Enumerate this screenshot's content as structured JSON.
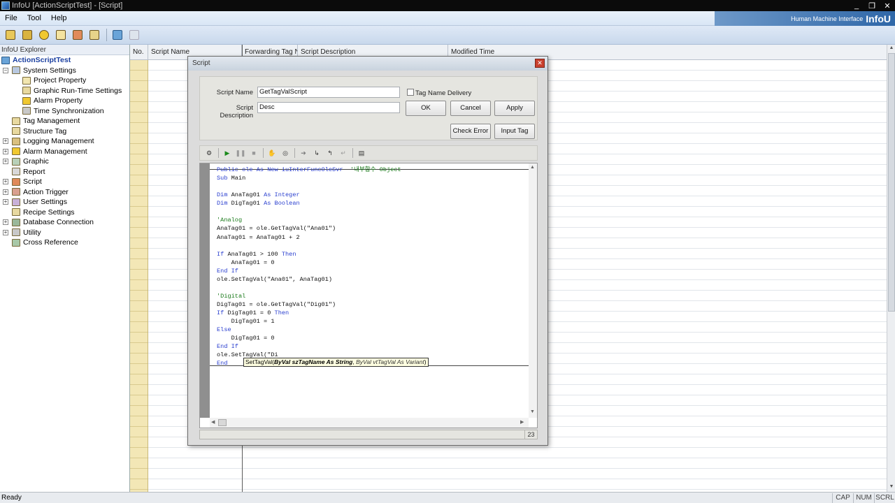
{
  "window": {
    "title": "InfoU [ActionScriptTest] - [Script]",
    "minimize": "_",
    "restore": "❐",
    "close": "✕"
  },
  "menu": [
    "File",
    "Tool",
    "Help"
  ],
  "brand": {
    "subtitle": "Human Machine Interface",
    "name": "InfoU"
  },
  "explorer": {
    "title": "InfoU Explorer",
    "root": "ActionScriptTest",
    "items": [
      {
        "label": "System Settings",
        "level": 1,
        "expanded": true
      },
      {
        "label": "Project Property",
        "level": 2
      },
      {
        "label": "Graphic Run-Time Settings",
        "level": 2
      },
      {
        "label": "Alarm Property",
        "level": 2
      },
      {
        "label": "Time Synchronization",
        "level": 2
      },
      {
        "label": "Tag Management",
        "level": 1
      },
      {
        "label": "Structure Tag",
        "level": 1
      },
      {
        "label": "Logging Management",
        "level": 1,
        "expanded": false
      },
      {
        "label": "Alarm Management",
        "level": 1,
        "expanded": false
      },
      {
        "label": "Graphic",
        "level": 1,
        "expanded": false
      },
      {
        "label": "Report",
        "level": 1
      },
      {
        "label": "Script",
        "level": 1,
        "expanded": false
      },
      {
        "label": "Action Trigger",
        "level": 1,
        "expanded": false
      },
      {
        "label": "User Settings",
        "level": 1,
        "expanded": false
      },
      {
        "label": "Recipe Settings",
        "level": 1
      },
      {
        "label": "Database Connection",
        "level": 1,
        "expanded": false
      },
      {
        "label": "Utility",
        "level": 1,
        "expanded": false
      },
      {
        "label": "Cross Reference",
        "level": 1
      }
    ]
  },
  "grid": {
    "columns": [
      "No.",
      "Script Name",
      "Forwarding Tag N...",
      "Script Description",
      "Modified Time"
    ]
  },
  "status": {
    "text": "Ready",
    "caps": "CAP",
    "num": "NUM",
    "scrl": "SCRL"
  },
  "dialog": {
    "title": "Script",
    "script_name_label": "Script Name",
    "script_name_value": "GetTagValScript",
    "tag_delivery_label": "Tag Name Delivery",
    "tag_delivery_checked": false,
    "script_desc_label": "Script Description",
    "script_desc_value": "Desc",
    "ok": "OK",
    "cancel": "Cancel",
    "apply": "Apply",
    "check_error": "Check Error",
    "input_tag": "Input Tag",
    "line_number": "23",
    "code_lines": [
      [
        [
          "kw",
          "Public ole As New iuInterFuncOleSvr"
        ],
        [
          "cm",
          "  '내부함수 Object"
        ]
      ],
      [
        [
          "kw",
          "Sub "
        ],
        [
          "pl",
          "Main"
        ]
      ],
      [],
      [
        [
          "kw",
          "Dim "
        ],
        [
          "pl",
          "AnaTag01 "
        ],
        [
          "kw",
          "As Integer"
        ]
      ],
      [
        [
          "kw",
          "Dim "
        ],
        [
          "pl",
          "DigTag01 "
        ],
        [
          "kw",
          "As Boolean"
        ]
      ],
      [],
      [
        [
          "cm",
          "'Analog"
        ]
      ],
      [
        [
          "pl",
          "AnaTag01 = ole.GetTagVal(\"Ana01\")"
        ]
      ],
      [
        [
          "pl",
          "AnaTag01 = AnaTag01 + 2"
        ]
      ],
      [],
      [
        [
          "kw",
          "If "
        ],
        [
          "pl",
          "AnaTag01 > 100 "
        ],
        [
          "kw",
          "Then"
        ]
      ],
      [
        [
          "pl",
          "    AnaTag01 = 0"
        ]
      ],
      [
        [
          "kw",
          "End If"
        ]
      ],
      [
        [
          "pl",
          "ole.SetTagVal(\"Ana01\", AnaTag01)"
        ]
      ],
      [],
      [
        [
          "cm",
          "'Digital"
        ]
      ],
      [
        [
          "pl",
          "DigTag01 = ole.GetTagVal(\"Dig01\")"
        ]
      ],
      [
        [
          "kw",
          "If "
        ],
        [
          "pl",
          "DigTag01 = 0 "
        ],
        [
          "kw",
          "Then"
        ]
      ],
      [
        [
          "pl",
          "    DigTag01 = 1"
        ]
      ],
      [
        [
          "kw",
          "Else"
        ]
      ],
      [
        [
          "pl",
          "    DigTag01 = 0"
        ]
      ],
      [
        [
          "kw",
          "End If"
        ]
      ],
      [
        [
          "pl",
          "ole.SetTagVal(\"Di"
        ]
      ],
      [
        [
          "kw",
          "End "
        ]
      ]
    ],
    "tooltip": {
      "fn": "SetTagVal(",
      "param1": "ByVal szTagName As String",
      "sep": ", ",
      "param2": "ByVal vtTagVal As Variant",
      "close": ")"
    }
  }
}
